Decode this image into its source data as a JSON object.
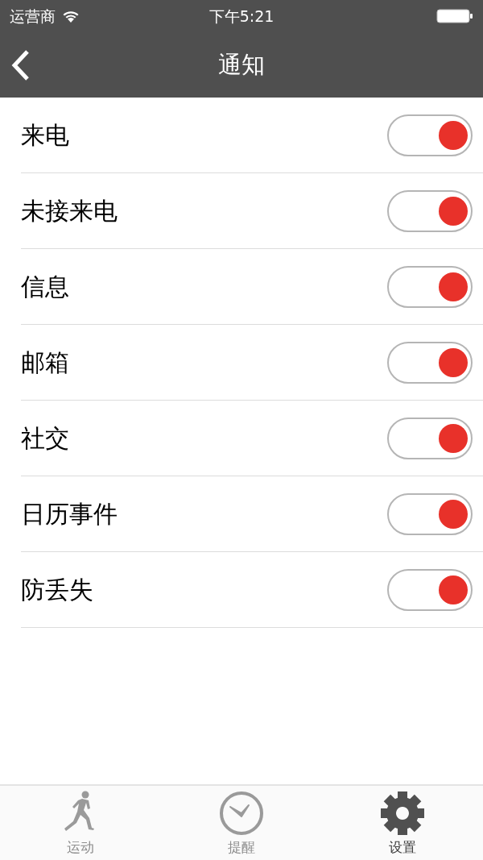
{
  "status_bar": {
    "carrier": "运营商",
    "time": "下午5:21"
  },
  "nav_bar": {
    "title": "通知"
  },
  "settings": [
    {
      "label": "来电",
      "on": true
    },
    {
      "label": "未接来电",
      "on": true
    },
    {
      "label": "信息",
      "on": true
    },
    {
      "label": "邮箱",
      "on": true
    },
    {
      "label": "社交",
      "on": true
    },
    {
      "label": "日历事件",
      "on": true
    },
    {
      "label": "防丢失",
      "on": true
    }
  ],
  "tab_bar": [
    {
      "kind": "runner",
      "label": "运动",
      "selected": false
    },
    {
      "kind": "clock",
      "label": "提醒",
      "selected": false
    },
    {
      "kind": "gear",
      "label": "设置",
      "selected": true
    }
  ]
}
